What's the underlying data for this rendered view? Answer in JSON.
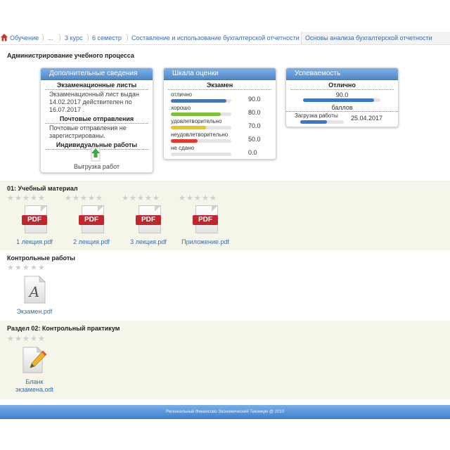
{
  "breadcrumb": {
    "items": [
      "Обучение",
      "...",
      "3 курс",
      "6 семестр",
      "Составление и использование бухгалтерской отчетности"
    ],
    "current": "Основы анализа бухгалтерской отчетности"
  },
  "page_title": "Администрирование учебного процесса",
  "card_info": {
    "title": "Дополнительные сведения",
    "exam_sheets_head": "Экзаменационные листы",
    "exam_sheets_text": "Экзаменационный лист выдан 14.02.2017 действителен по 16.07.2017 .",
    "mail_head": "Почтовые отправления",
    "mail_text": "Почтовые отправления не зарегистрированы.",
    "individual_head": "Индивидуальные работы",
    "upload_label": "Выгрузка работ"
  },
  "card_scale": {
    "title": "Шкала оценки",
    "subhead": "Экзамен",
    "grades": [
      {
        "label": "отлично",
        "value": "90.0",
        "fill": 0.92,
        "color": "#3a78c8"
      },
      {
        "label": "хорошо",
        "value": "80.0",
        "fill": 0.82,
        "color": "#7cc13a"
      },
      {
        "label": "удовлетворительно",
        "value": "70.0",
        "fill": 0.58,
        "color": "#e6c619"
      },
      {
        "label": "неудовлетворительно",
        "value": "50.0",
        "fill": 0.44,
        "color": "#e03a2f"
      },
      {
        "label": "не сдано",
        "value": "0.0",
        "fill": 0.0,
        "color": "#bbbbbb"
      }
    ]
  },
  "card_progress": {
    "title": "Успеваемость",
    "subhead": "Отлично",
    "score": "90.0",
    "score_fill": 0.92,
    "score_unit": "баллов",
    "upload_label": "Загрузка работы",
    "upload_date": "25.04.2017",
    "upload_fill": 0.62,
    "bar_color": "#3a78c8"
  },
  "section1": {
    "title": "01: Учебный материал",
    "files": [
      "1 лекция.pdf",
      "2 лекция.pdf",
      "3 лекция.pdf",
      "Приложение.pdf"
    ],
    "file_type_label": "PDF"
  },
  "section2": {
    "title": "Контрольные работы",
    "files": [
      "Экзамен.pdf"
    ]
  },
  "section3": {
    "title": "Раздел 02: Контрольный практикум",
    "file_line1": "Бланк",
    "file_line2": "экзамена.odt"
  },
  "footer_text": "Региональный Финансово Экономический Техникум @ 2010"
}
